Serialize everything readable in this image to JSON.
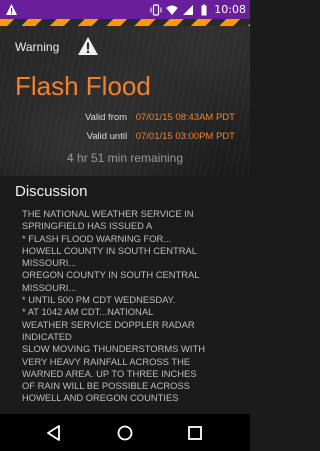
{
  "status_bar": {
    "time": "10:08",
    "background": "#6a1f9a"
  },
  "alert": {
    "category": "Warning",
    "icon": "warning-triangle-icon",
    "title": "Flash Flood",
    "valid_from_label": "Valid from",
    "valid_from": "07/01/15 08:43AM PDT",
    "valid_until_label": "Valid until",
    "valid_until": "07/01/15 03:00PM PDT",
    "remaining": "4 hr 51 min remaining",
    "accent_color": "#f2812d"
  },
  "discussion": {
    "title": "Discussion",
    "lines": [
      "THE NATIONAL WEATHER SERVICE IN",
      "SPRINGFIELD HAS ISSUED A",
      "* FLASH FLOOD WARNING FOR...",
      "HOWELL COUNTY IN SOUTH CENTRAL",
      "MISSOURI...",
      "OREGON COUNTY IN SOUTH CENTRAL",
      "MISSOURI...",
      "* UNTIL 500 PM CDT WEDNESDAY.",
      "* AT 1042 AM CDT...NATIONAL",
      "WEATHER SERVICE DOPPLER RADAR",
      "INDICATED",
      "SLOW MOVING THUNDERSTORMS WITH",
      "VERY HEAVY RAINFALL ACROSS THE",
      "WARNED AREA. UP TO THREE INCHES",
      "OF RAIN WILL BE POSSIBLE ACROSS",
      "HOWELL AND OREGON COUNTIES"
    ]
  },
  "nav_bar": {
    "back": "back-icon",
    "home": "home-icon",
    "recents": "recents-icon"
  }
}
